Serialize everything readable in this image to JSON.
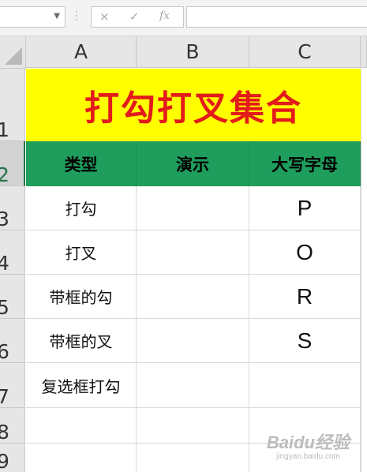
{
  "formula_bar": {
    "name_box_value": "",
    "cancel_icon": "×",
    "enter_icon": "✓",
    "fx_label": "fx",
    "formula_value": ""
  },
  "columns": [
    "A",
    "B",
    "C"
  ],
  "rows": [
    "1",
    "2",
    "3",
    "4",
    "5",
    "6",
    "7",
    "8",
    "9"
  ],
  "sheet": {
    "title": "打勾打叉集合",
    "headers": [
      "类型",
      "演示",
      "大写字母"
    ],
    "data": [
      {
        "type": "打勾",
        "demo": "",
        "letter": "P"
      },
      {
        "type": "打叉",
        "demo": "",
        "letter": "O"
      },
      {
        "type": "带框的勾",
        "demo": "",
        "letter": "R"
      },
      {
        "type": "带框的叉",
        "demo": "",
        "letter": "S"
      },
      {
        "type": "复选框打勾",
        "demo": "",
        "letter": ""
      }
    ]
  },
  "colors": {
    "title_bg": "#ffff00",
    "title_text": "#e21b1b",
    "header_bg": "#1f9d5c",
    "selected_row": "#217346"
  },
  "watermark": {
    "logo": "Baidu经验",
    "url": "jingyan.baidu.com"
  }
}
